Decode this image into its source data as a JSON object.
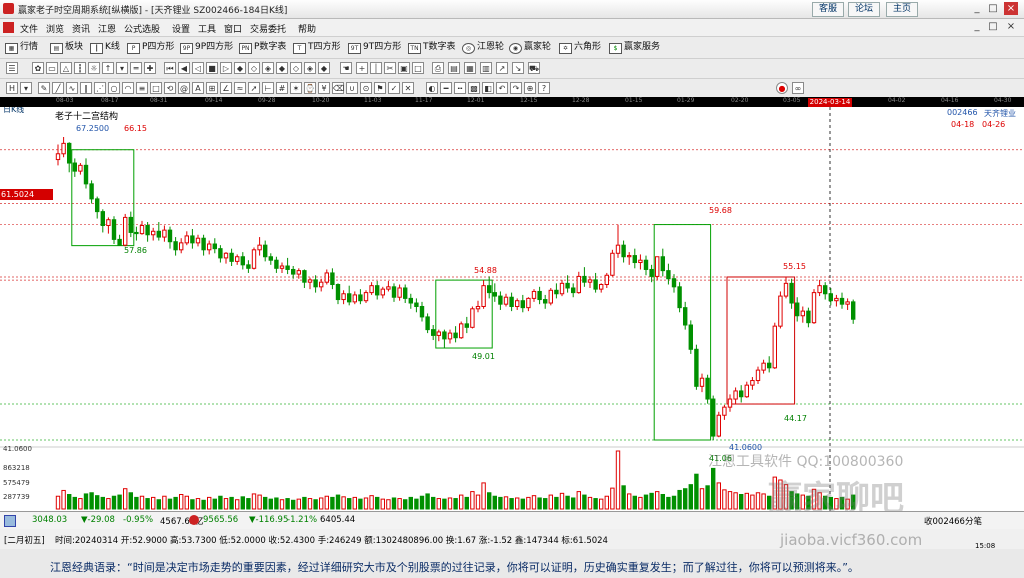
{
  "window": {
    "title": "赢家老子时空周期系统[纵横版] - [天齐锂业   SZ002466-184日K线]",
    "links": [
      "客服",
      "论坛",
      "主页"
    ],
    "controls": [
      "_",
      "□",
      "×"
    ]
  },
  "menu": {
    "items": [
      "文件",
      "浏览",
      "资讯",
      "江恩",
      "公式选股",
      "设置",
      "工具",
      "窗口",
      "交易委托",
      "帮助"
    ],
    "right_controls": [
      "_",
      "□",
      "×"
    ]
  },
  "toolbar1": {
    "items": [
      {
        "icon": "grid-icon",
        "label": "行情"
      },
      {
        "icon": "blocks-icon",
        "label": "板块"
      },
      {
        "icon": "kline-icon",
        "label": "K线"
      },
      {
        "icon": "p-square-icon",
        "label": "P四方形"
      },
      {
        "icon": "9p-icon",
        "label": "9P四方形"
      },
      {
        "icon": "pn-icon",
        "label": "P数字表"
      },
      {
        "icon": "t-icon",
        "label": "T四方形"
      },
      {
        "icon": "9t-icon",
        "label": "9T四方形"
      },
      {
        "icon": "tn-icon",
        "label": "T数字表"
      },
      {
        "icon": "gann-wheel-icon",
        "label": "江恩轮"
      },
      {
        "icon": "winner-wheel-icon",
        "label": "赢家轮"
      },
      {
        "icon": "hexagon-icon",
        "label": "六角形"
      },
      {
        "icon": "dollar-icon",
        "label": "赢家服务"
      }
    ]
  },
  "ruler": {
    "ticks": [
      "08-03",
      "08-17",
      "08-31",
      "09-14",
      "09-28",
      "10-20",
      "11-03",
      "11-17",
      "12-01",
      "12-15",
      "12-28",
      "01-15",
      "01-29",
      "02-20",
      "03-05",
      "04-02",
      "04-16",
      "04-30"
    ],
    "highlight": "2024-03-14"
  },
  "chart": {
    "period_label": "日K线",
    "structure_label": "老子十二宫结构",
    "current_price_box": "61.5024",
    "stock_code": "002466",
    "stock_name": "天齐锂业",
    "future_dates": [
      "04-18",
      "04-26"
    ],
    "y_labels": [
      "41.0600",
      "863218",
      "575479",
      "287739"
    ],
    "annotations": [
      "67.2500",
      "66.15",
      "57.86",
      "59.68",
      "54.88",
      "55.15",
      "49.01",
      "44.17",
      "41.0600",
      "41.06"
    ],
    "watermark1": "江恩工具软件  QQ:100800360",
    "watermark2": "赢家聊吧",
    "watermark3": "jiaoba.vicf360.com"
  },
  "chart_data": {
    "type": "candlestick",
    "title": "天齐锂业 SZ002466 日K线",
    "xlabel": "",
    "ylabel": "",
    "ylim": [
      41.06,
      67.25
    ],
    "candles": [
      [
        65.3,
        66.6,
        65.8,
        64.8
      ],
      [
        65.8,
        67.25,
        66.7,
        65.5
      ],
      [
        66.7,
        66.8,
        65.0,
        64.2
      ],
      [
        65.0,
        65.4,
        64.3,
        63.8
      ],
      [
        64.3,
        65.0,
        64.8,
        64.0
      ],
      [
        64.8,
        65.4,
        63.2,
        62.8
      ],
      [
        63.2,
        63.5,
        61.9,
        61.5
      ],
      [
        61.9,
        62.1,
        60.8,
        60.2
      ],
      [
        60.8,
        61.0,
        59.6,
        59.0
      ],
      [
        59.6,
        60.3,
        60.1,
        58.9
      ],
      [
        60.1,
        60.4,
        58.4,
        58.0
      ],
      [
        58.4,
        58.8,
        57.9,
        57.86
      ],
      [
        57.9,
        60.6,
        60.3,
        57.8
      ],
      [
        60.3,
        60.8,
        59.0,
        58.6
      ],
      [
        59.0,
        59.5,
        58.9,
        58.3
      ],
      [
        58.9,
        60.0,
        59.6,
        58.8
      ],
      [
        59.6,
        59.9,
        58.8,
        58.2
      ],
      [
        58.8,
        59.4,
        59.1,
        58.3
      ],
      [
        59.1,
        59.9,
        58.6,
        58.3
      ],
      [
        58.6,
        59.6,
        59.2,
        58.2
      ],
      [
        59.2,
        59.5,
        58.2,
        57.6
      ],
      [
        58.2,
        58.6,
        57.5,
        57.0
      ],
      [
        57.5,
        58.5,
        58.1,
        57.2
      ],
      [
        58.1,
        59.1,
        58.7,
        57.9
      ],
      [
        58.7,
        59.3,
        58.1,
        57.6
      ],
      [
        58.1,
        58.8,
        58.5,
        57.8
      ],
      [
        58.5,
        58.8,
        57.5,
        57.0
      ],
      [
        57.5,
        58.3,
        58.0,
        57.1
      ],
      [
        58.0,
        58.5,
        57.6,
        57.2
      ],
      [
        57.6,
        57.9,
        56.8,
        56.4
      ],
      [
        56.8,
        57.3,
        57.2,
        56.3
      ],
      [
        57.2,
        57.6,
        56.5,
        56.1
      ],
      [
        56.5,
        57.1,
        56.9,
        56.2
      ],
      [
        56.9,
        57.3,
        56.2,
        55.8
      ],
      [
        56.2,
        56.6,
        55.9,
        55.5
      ],
      [
        55.9,
        57.7,
        57.5,
        55.8
      ],
      [
        57.5,
        58.6,
        57.9,
        57.0
      ],
      [
        57.9,
        58.3,
        56.9,
        56.5
      ],
      [
        56.9,
        57.2,
        56.6,
        56.2
      ],
      [
        56.6,
        56.9,
        55.9,
        55.5
      ],
      [
        55.9,
        56.4,
        56.1,
        55.5
      ],
      [
        56.1,
        56.8,
        55.8,
        55.4
      ],
      [
        55.8,
        56.1,
        55.4,
        55.0
      ],
      [
        55.4,
        55.9,
        55.7,
        55.0
      ],
      [
        55.7,
        55.8,
        54.7,
        54.2
      ],
      [
        54.7,
        55.1,
        54.9,
        54.1
      ],
      [
        54.9,
        55.3,
        54.3,
        53.8
      ],
      [
        54.3,
        55.0,
        54.7,
        53.9
      ],
      [
        54.7,
        55.8,
        55.5,
        54.5
      ],
      [
        55.5,
        55.9,
        54.5,
        54.1
      ],
      [
        54.5,
        54.6,
        53.2,
        52.8
      ],
      [
        53.2,
        54.0,
        53.7,
        52.8
      ],
      [
        53.7,
        54.4,
        53.0,
        52.7
      ],
      [
        53.0,
        53.9,
        53.6,
        52.8
      ],
      [
        53.6,
        54.1,
        53.1,
        52.8
      ],
      [
        53.1,
        54.0,
        53.8,
        52.9
      ],
      [
        53.8,
        54.7,
        54.4,
        53.6
      ],
      [
        54.4,
        54.8,
        53.6,
        53.2
      ],
      [
        53.6,
        54.3,
        54.1,
        53.3
      ],
      [
        54.1,
        54.8,
        54.3,
        53.9
      ],
      [
        54.3,
        54.6,
        53.4,
        53.0
      ],
      [
        53.4,
        54.5,
        54.2,
        53.1
      ],
      [
        54.2,
        54.5,
        53.3,
        52.9
      ],
      [
        53.3,
        53.7,
        52.9,
        52.4
      ],
      [
        52.9,
        53.3,
        52.6,
        52.1
      ],
      [
        52.6,
        53.0,
        51.7,
        51.3
      ],
      [
        51.7,
        52.0,
        50.6,
        50.3
      ],
      [
        50.6,
        51.0,
        50.1,
        49.7
      ],
      [
        50.1,
        50.6,
        50.4,
        49.6
      ],
      [
        50.4,
        50.6,
        49.8,
        49.01
      ],
      [
        49.8,
        50.6,
        50.3,
        49.4
      ],
      [
        50.3,
        50.9,
        49.9,
        49.5
      ],
      [
        49.9,
        51.3,
        51.1,
        49.8
      ],
      [
        51.1,
        51.7,
        50.8,
        50.3
      ],
      [
        50.8,
        52.6,
        52.4,
        50.7
      ],
      [
        52.4,
        53.1,
        52.6,
        52.1
      ],
      [
        52.6,
        54.88,
        54.4,
        52.4
      ],
      [
        54.4,
        55.2,
        53.8,
        53.3
      ],
      [
        53.8,
        54.6,
        53.5,
        53.0
      ],
      [
        53.5,
        53.9,
        52.8,
        52.3
      ],
      [
        52.8,
        53.7,
        53.4,
        52.6
      ],
      [
        53.4,
        53.8,
        52.6,
        52.2
      ],
      [
        52.6,
        53.3,
        53.1,
        52.3
      ],
      [
        53.1,
        53.6,
        52.5,
        52.1
      ],
      [
        52.5,
        53.4,
        53.3,
        52.2
      ],
      [
        53.3,
        54.1,
        53.9,
        53.0
      ],
      [
        53.9,
        54.3,
        53.2,
        52.8
      ],
      [
        53.2,
        53.6,
        52.9,
        52.4
      ],
      [
        52.9,
        54.2,
        54.0,
        52.7
      ],
      [
        54.0,
        54.6,
        53.7,
        53.3
      ],
      [
        53.7,
        54.9,
        54.6,
        53.5
      ],
      [
        54.6,
        55.3,
        54.2,
        53.8
      ],
      [
        54.2,
        54.6,
        53.8,
        53.4
      ],
      [
        53.8,
        55.6,
        55.2,
        53.7
      ],
      [
        55.2,
        56.0,
        54.7,
        54.3
      ],
      [
        54.7,
        55.2,
        54.9,
        54.2
      ],
      [
        54.9,
        55.5,
        54.1,
        53.8
      ],
      [
        54.1,
        54.6,
        54.5,
        53.8
      ],
      [
        54.5,
        55.5,
        55.3,
        54.2
      ],
      [
        55.3,
        57.5,
        57.2,
        55.2
      ],
      [
        57.2,
        59.68,
        57.9,
        56.8
      ],
      [
        57.9,
        58.3,
        56.9,
        56.4
      ],
      [
        56.9,
        57.3,
        57.0,
        56.2
      ],
      [
        57.0,
        57.6,
        56.4,
        55.9
      ],
      [
        56.4,
        57.1,
        56.6,
        55.8
      ],
      [
        56.6,
        57.0,
        55.8,
        55.3
      ],
      [
        55.8,
        56.2,
        55.2,
        54.7
      ],
      [
        55.2,
        55.6,
        56.9,
        54.9
      ],
      [
        56.9,
        57.6,
        55.7,
        55.2
      ],
      [
        55.7,
        56.3,
        55.0,
        54.5
      ],
      [
        55.0,
        55.4,
        54.3,
        53.8
      ],
      [
        54.3,
        54.7,
        52.5,
        52.1
      ],
      [
        52.5,
        53.0,
        51.0,
        50.6
      ],
      [
        51.0,
        51.4,
        48.9,
        48.5
      ],
      [
        48.9,
        49.3,
        45.7,
        45.4
      ],
      [
        45.7,
        46.8,
        46.4,
        45.2
      ],
      [
        46.4,
        46.7,
        44.6,
        44.2
      ],
      [
        44.6,
        44.9,
        41.4,
        41.06
      ],
      [
        41.4,
        43.5,
        43.2,
        41.3
      ],
      [
        43.2,
        44.1,
        43.9,
        42.8
      ],
      [
        43.9,
        45.0,
        44.6,
        43.5
      ],
      [
        44.6,
        45.6,
        45.3,
        44.2
      ],
      [
        45.3,
        45.8,
        44.8,
        44.3
      ],
      [
        44.8,
        46.1,
        45.8,
        44.7
      ],
      [
        45.8,
        46.5,
        46.2,
        45.4
      ],
      [
        46.2,
        47.4,
        47.1,
        45.9
      ],
      [
        47.1,
        48.0,
        47.7,
        46.8
      ],
      [
        47.7,
        48.3,
        47.3,
        46.9
      ],
      [
        47.3,
        51.2,
        50.9,
        47.2
      ],
      [
        50.9,
        53.9,
        53.5,
        50.7
      ],
      [
        53.5,
        55.15,
        54.6,
        53.3
      ],
      [
        54.6,
        55.0,
        52.9,
        52.4
      ],
      [
        52.9,
        53.4,
        51.8,
        51.3
      ],
      [
        51.8,
        52.6,
        52.2,
        51.2
      ],
      [
        52.2,
        52.5,
        51.2,
        50.8
      ],
      [
        51.2,
        54.1,
        53.8,
        51.1
      ],
      [
        53.8,
        54.9,
        54.4,
        53.5
      ],
      [
        54.4,
        54.7,
        53.7,
        53.2
      ],
      [
        53.7,
        54.2,
        53.1,
        52.7
      ],
      [
        53.1,
        53.6,
        53.3,
        52.6
      ],
      [
        53.3,
        53.8,
        52.8,
        52.4
      ],
      [
        52.8,
        53.3,
        53.0,
        52.3
      ],
      [
        53.0,
        53.2,
        51.5,
        51.1
      ]
    ],
    "volume_relative": [
      0.22,
      0.32,
      0.25,
      0.2,
      0.18,
      0.26,
      0.28,
      0.23,
      0.2,
      0.18,
      0.22,
      0.24,
      0.35,
      0.28,
      0.2,
      0.22,
      0.18,
      0.2,
      0.16,
      0.22,
      0.17,
      0.2,
      0.25,
      0.22,
      0.16,
      0.18,
      0.15,
      0.2,
      0.17,
      0.22,
      0.18,
      0.2,
      0.16,
      0.21,
      0.18,
      0.26,
      0.24,
      0.2,
      0.17,
      0.19,
      0.16,
      0.18,
      0.15,
      0.17,
      0.2,
      0.18,
      0.16,
      0.19,
      0.22,
      0.2,
      0.24,
      0.21,
      0.18,
      0.2,
      0.17,
      0.19,
      0.23,
      0.2,
      0.17,
      0.16,
      0.19,
      0.18,
      0.16,
      0.2,
      0.17,
      0.22,
      0.26,
      0.2,
      0.18,
      0.17,
      0.19,
      0.18,
      0.24,
      0.2,
      0.3,
      0.24,
      0.45,
      0.28,
      0.22,
      0.2,
      0.21,
      0.18,
      0.19,
      0.17,
      0.2,
      0.23,
      0.19,
      0.18,
      0.24,
      0.2,
      0.27,
      0.22,
      0.19,
      0.3,
      0.24,
      0.2,
      0.18,
      0.17,
      0.22,
      0.36,
      1.0,
      0.4,
      0.26,
      0.22,
      0.2,
      0.24,
      0.27,
      0.3,
      0.25,
      0.2,
      0.22,
      0.32,
      0.35,
      0.42,
      0.6,
      0.35,
      0.4,
      0.7,
      0.45,
      0.33,
      0.3,
      0.28,
      0.25,
      0.27,
      0.24,
      0.28,
      0.26,
      0.22,
      0.55,
      0.5,
      0.42,
      0.3,
      0.26,
      0.24,
      0.22,
      0.34,
      0.28,
      0.22,
      0.2,
      0.18,
      0.2,
      0.17,
      0.24
    ]
  },
  "indices": {
    "sh": {
      "value": "3048.03",
      "change": "▼-29.08",
      "pct": "-0.95%",
      "amount": "4567.62亿"
    },
    "sz": {
      "value": "9565.56",
      "change": "▼-116.95",
      "pct": "-1.21%",
      "amount": "6405.44"
    },
    "watch": "收002466分笔"
  },
  "status": {
    "lunar": "[二月初五]",
    "text": "时间:20240314  开:52.9000  高:53.7300  低:52.0000  收:52.4300  手:246249  额:1302480896.00  换:1.67  涨:-1.52  鑫:147344  标:61.5024",
    "clock": "15:08"
  },
  "quote": {
    "text": "江恩经典语录：“时间是决定市场走势的重要因素，经过详细研究大市及个别股票的过往记录，你将可以证明，历史确实重复发生；而了解过往，你将可以预测将来。”。"
  },
  "colors": {
    "up": "#e00000",
    "down": "#009000",
    "box_green": "#00a000",
    "box_red": "#d00000",
    "accent_red": "#d40000"
  }
}
